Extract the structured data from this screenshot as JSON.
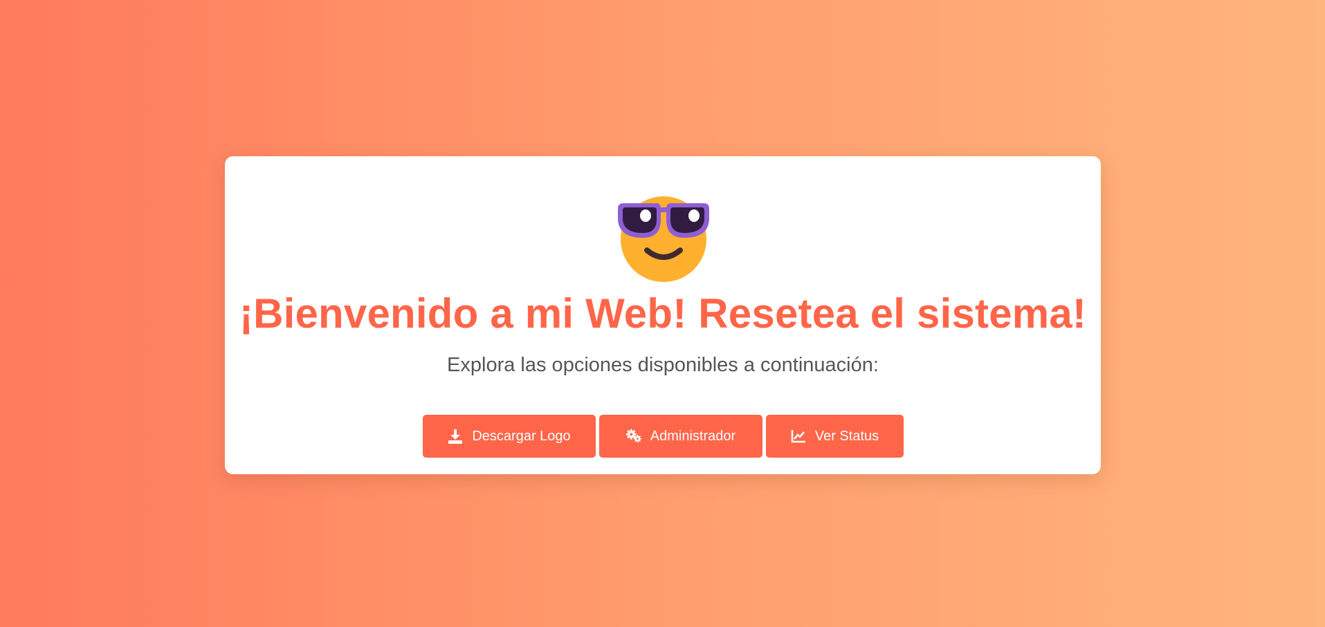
{
  "page": {
    "title": "¡Bienvenido a mi Web! Resetea el sistema!",
    "subtitle": "Explora las opciones disponibles a continuación:"
  },
  "hero_icon": "smiling-face-with-sunglasses-emoji",
  "buttons": [
    {
      "label": "Descargar Logo",
      "icon": "download-icon"
    },
    {
      "label": "Administrador",
      "icon": "gears-icon"
    },
    {
      "label": "Ver Status",
      "icon": "line-chart-icon"
    }
  ],
  "colors": {
    "accent": "#ff6548",
    "background_start": "#ff7b5c",
    "background_end": "#ffb57d",
    "card": "#ffffff",
    "subtitle_text": "#555555"
  }
}
